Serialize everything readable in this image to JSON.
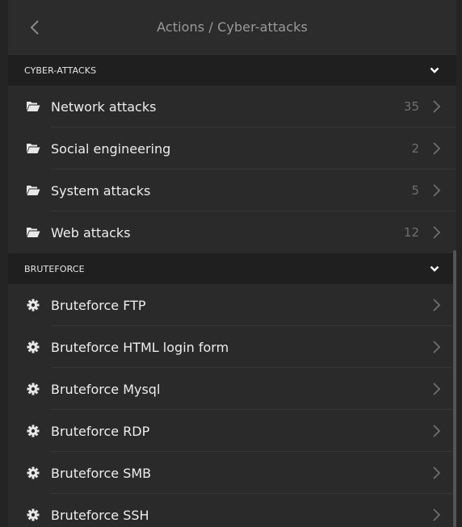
{
  "header": {
    "title": "Actions / Cyber-attacks"
  },
  "sections": [
    {
      "label": "CYBER-ATTACKS",
      "items": [
        {
          "label": "Network attacks",
          "count": "35",
          "icon": "folder-open-icon"
        },
        {
          "label": "Social engineering",
          "count": "2",
          "icon": "folder-open-icon"
        },
        {
          "label": "System attacks",
          "count": "5",
          "icon": "folder-open-icon"
        },
        {
          "label": "Web attacks",
          "count": "12",
          "icon": "folder-open-icon"
        }
      ]
    },
    {
      "label": "BRUTEFORCE",
      "items": [
        {
          "label": "Bruteforce FTP",
          "icon": "gear-icon"
        },
        {
          "label": "Bruteforce HTML login form",
          "icon": "gear-icon"
        },
        {
          "label": "Bruteforce Mysql",
          "icon": "gear-icon"
        },
        {
          "label": "Bruteforce RDP",
          "icon": "gear-icon"
        },
        {
          "label": "Bruteforce SMB",
          "icon": "gear-icon"
        },
        {
          "label": "Bruteforce SSH",
          "icon": "gear-icon"
        }
      ]
    }
  ],
  "colors": {
    "background": "#2a2a2a",
    "section_background": "#1f1f1f",
    "text": "#ededed",
    "muted": "#6f6f6f"
  }
}
